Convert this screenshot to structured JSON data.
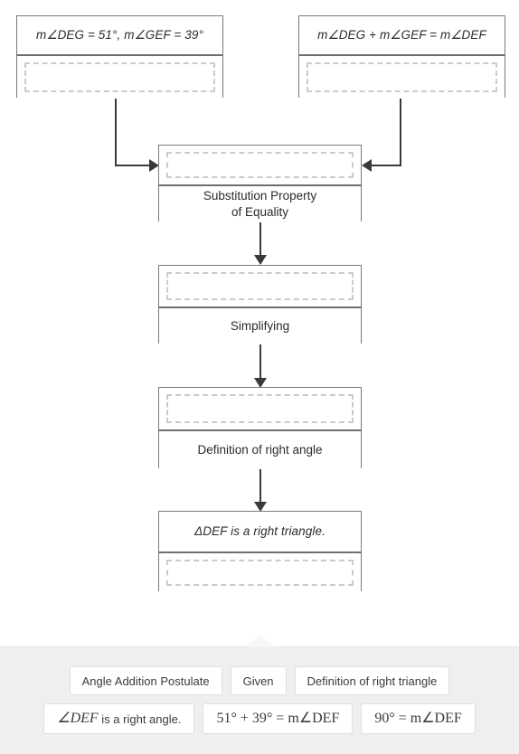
{
  "proof": {
    "top_row": [
      {
        "statement": "m∠DEG = 51°, m∠GEF = 39°",
        "reason": "",
        "reason_empty": true
      },
      {
        "statement": "m∠DEG + m∠GEF = m∠DEF",
        "reason": "",
        "reason_empty": true
      }
    ],
    "chain": [
      {
        "statement": "",
        "statement_empty": true,
        "reason": "Substitution Property\nof Equality",
        "reason_empty": false
      },
      {
        "statement": "",
        "statement_empty": true,
        "reason": "Simplifying",
        "reason_empty": false
      },
      {
        "statement": "",
        "statement_empty": true,
        "reason": "Definition of right angle",
        "reason_empty": false
      },
      {
        "statement": "ΔDEF is a right triangle.",
        "statement_empty": false,
        "reason": "",
        "reason_empty": true
      }
    ]
  },
  "tray": {
    "row1": [
      {
        "label": "Angle Addition Postulate"
      },
      {
        "label": "Given"
      },
      {
        "label": "Definition of right triangle"
      }
    ],
    "row2": [
      {
        "label": "∠DEF is a right angle."
      },
      {
        "label": "51° + 39° = m∠DEF"
      },
      {
        "label": "90° = m∠DEF"
      }
    ]
  },
  "colors": {
    "tray_bg": "#efeff0",
    "box_border": "#7a7a7a",
    "slot_border": "#cbcbcb",
    "connector": "#3a3a3a",
    "text": "#2b2b2b"
  }
}
